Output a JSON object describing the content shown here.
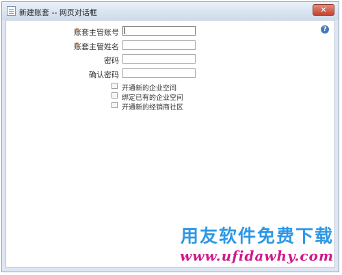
{
  "window": {
    "title": "新建账套 -- 网页对话框",
    "close_label": "✕"
  },
  "help": {
    "label": "?"
  },
  "form": {
    "fields": [
      {
        "label": "账套主管账号",
        "required": true,
        "value": ""
      },
      {
        "label": "账套主管姓名",
        "required": true,
        "value": ""
      },
      {
        "label": "密码",
        "required": false,
        "value": ""
      },
      {
        "label": "确认密码",
        "required": false,
        "value": ""
      }
    ],
    "required_mark": "*",
    "checkboxes": [
      {
        "label": "开通新的企业空间",
        "checked": false
      },
      {
        "label": "绑定已有的企业空间",
        "checked": false
      },
      {
        "label": "开通新的经销商社区",
        "checked": false
      }
    ]
  },
  "watermark": {
    "title": "用友软件免费下载",
    "url": "www.ufidawhy.com"
  }
}
